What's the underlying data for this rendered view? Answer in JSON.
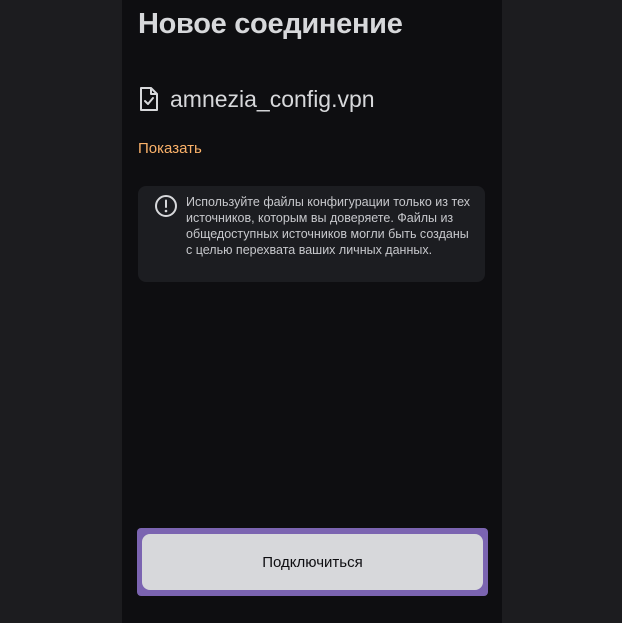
{
  "page": {
    "title": "Новое соединение"
  },
  "file": {
    "name": "amnezia_config.vpn",
    "icon": "file-check-icon"
  },
  "actions": {
    "show_label": "Показать",
    "connect_label": "Подключиться"
  },
  "warning": {
    "icon": "exclamation-circle-icon",
    "text": "Используйте файлы конфигурации только из тех источников, которым вы доверяете. Файлы из общедоступных источников могли быть созданы с целью перехвата ваших личных данных."
  },
  "colors": {
    "background": "#1c1c1f",
    "panel": "#0e0e11",
    "text_primary": "#d7d8db",
    "accent_link": "#fbb26a",
    "card": "#1c1d21",
    "focus_outline": "#7b64b1",
    "button_fill": "#d7d8db"
  }
}
